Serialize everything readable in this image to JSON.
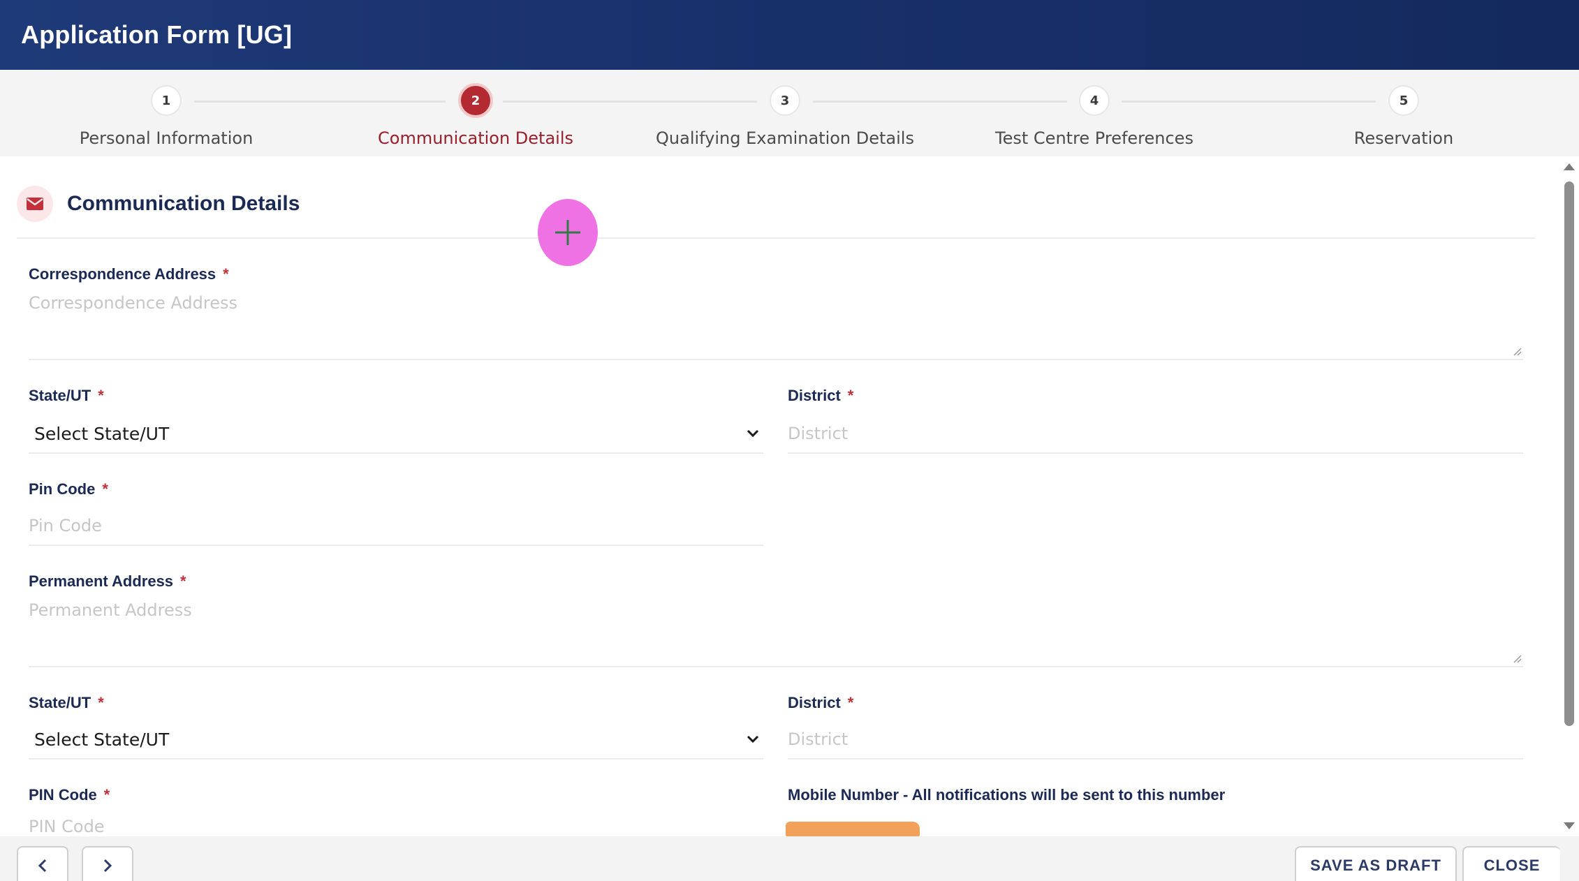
{
  "header": {
    "title": "Application Form [UG]"
  },
  "steps": [
    {
      "number": "1",
      "label": "Personal Information"
    },
    {
      "number": "2",
      "label": "Communication Details"
    },
    {
      "number": "3",
      "label": "Qualifying Examination Details"
    },
    {
      "number": "4",
      "label": "Test Centre Preferences"
    },
    {
      "number": "5",
      "label": "Reservation"
    }
  ],
  "active_step": 2,
  "section": {
    "title": "Communication Details",
    "icon": "envelope-icon"
  },
  "form": {
    "correspondence_address": {
      "label": "Correspondence Address",
      "placeholder": "Correspondence Address"
    },
    "state_1": {
      "label": "State/UT",
      "value": "Select State/UT"
    },
    "district_1": {
      "label": "District",
      "placeholder": "District"
    },
    "pin_code_1": {
      "label": "Pin Code",
      "placeholder": "Pin Code"
    },
    "permanent_address": {
      "label": "Permanent Address",
      "placeholder": "Permanent Address"
    },
    "state_2": {
      "label": "State/UT",
      "value": "Select State/UT"
    },
    "district_2": {
      "label": "District",
      "placeholder": "District"
    },
    "pin_code_2": {
      "label": "PIN Code",
      "placeholder": "PIN Code"
    },
    "mobile": {
      "label": "Mobile Number - All notifications will be sent to this number"
    },
    "required_marker": "*"
  },
  "footer": {
    "save_draft_label": "SAVE AS DRAFT",
    "close_label": "CLOSE"
  },
  "colors": {
    "header_bg": "#1a3470",
    "active_step": "#b32a33",
    "label_text": "#1b2a55",
    "required": "#c4303a",
    "fab": "#ee72e4",
    "redaction": "#f2a15a"
  }
}
